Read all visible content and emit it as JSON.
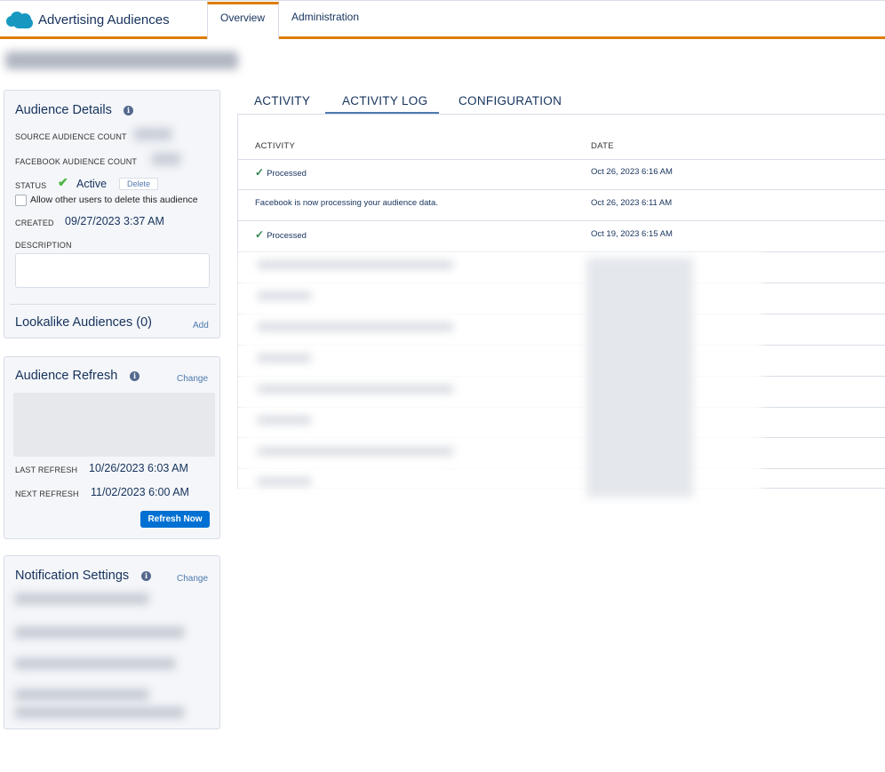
{
  "header": {
    "app_name": "Advertising Audiences",
    "tabs": [
      "Overview",
      "Administration"
    ]
  },
  "audience_details": {
    "title": "Audience Details",
    "source_count_label": "SOURCE AUDIENCE COUNT",
    "facebook_count_label": "FACEBOOK AUDIENCE COUNT",
    "status_label": "STATUS",
    "status_value": "Active",
    "delete_label": "Delete",
    "allow_delete_label": "Allow other users to delete this audience",
    "created_label": "CREATED",
    "created_value": "09/27/2023 3:37 AM",
    "description_label": "DESCRIPTION",
    "lookalike_label": "Lookalike Audiences (0)",
    "add_label": "Add"
  },
  "audience_refresh": {
    "title": "Audience Refresh",
    "change_label": "Change",
    "last_refresh_label": "LAST REFRESH",
    "last_refresh_value": "10/26/2023 6:03 AM",
    "next_refresh_label": "NEXT REFRESH",
    "next_refresh_value": "11/02/2023 6:00 AM",
    "refresh_button": "Refresh Now"
  },
  "notifications": {
    "title": "Notification Settings",
    "change_label": "Change"
  },
  "activity": {
    "tabs": [
      "ACTIVITY",
      "ACTIVITY LOG",
      "CONFIGURATION"
    ],
    "columns": [
      "ACTIVITY",
      "DATE"
    ],
    "rows": [
      {
        "activity": "Processed",
        "date": "Oct 26, 2023 6:16 AM"
      },
      {
        "activity": "Facebook is now processing your audience data.",
        "date": "Oct 26, 2023 6:11 AM"
      },
      {
        "activity": "Processed",
        "date": "Oct 19, 2023 6:15 AM"
      }
    ]
  },
  "colors": {
    "accent_orange": "#e07c00",
    "brand_blue": "#0070d2",
    "success_green": "#2e844a"
  }
}
